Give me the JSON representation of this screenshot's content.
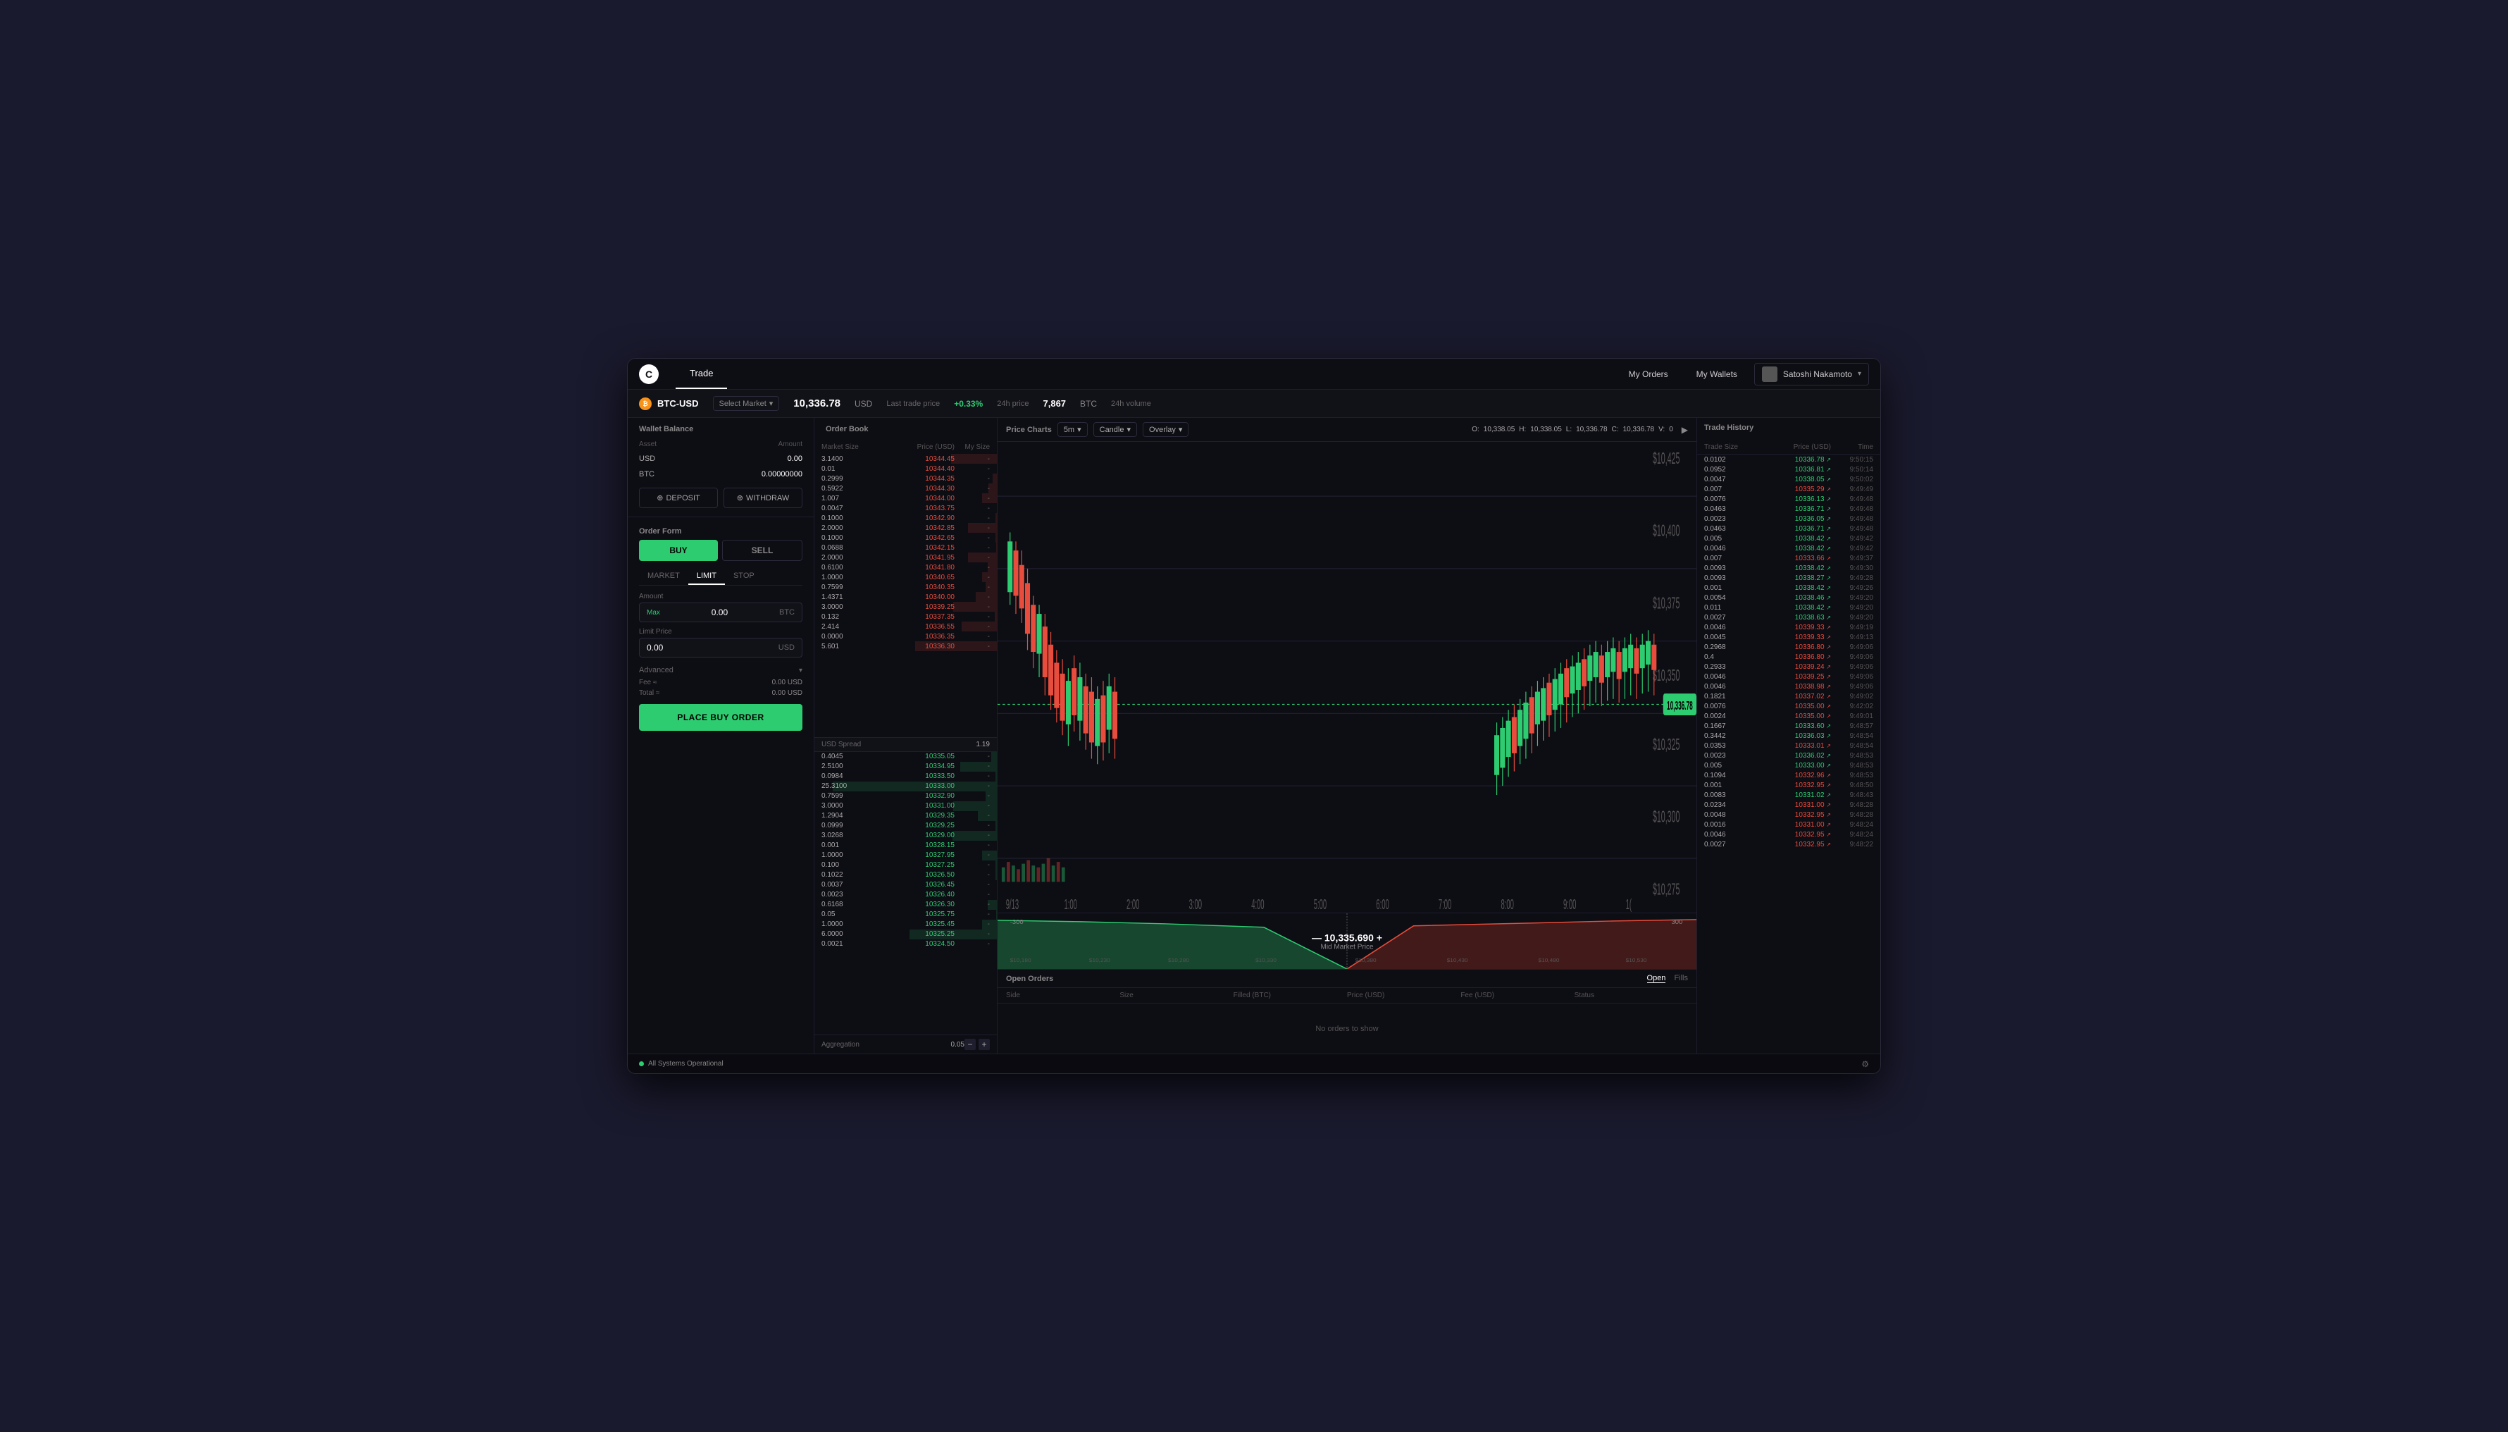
{
  "window": {
    "title": "Coinbase Pro",
    "logo": "C"
  },
  "nav": {
    "tabs": [
      {
        "label": "Trade",
        "active": true
      }
    ],
    "my_orders": "My Orders",
    "my_wallets": "My Wallets",
    "user": "Satoshi Nakamoto"
  },
  "ticker": {
    "pair": "BTC-USD",
    "market_select": "Select Market",
    "last_price": "10,336.78",
    "last_price_unit": "USD",
    "last_price_label": "Last trade price",
    "change_24h": "+0.33%",
    "change_24h_label": "24h price",
    "volume_24h": "7,867",
    "volume_24h_unit": "BTC",
    "volume_24h_label": "24h volume"
  },
  "wallet": {
    "section_title": "Wallet Balance",
    "columns": {
      "asset": "Asset",
      "amount": "Amount"
    },
    "assets": [
      {
        "name": "USD",
        "amount": "0.00"
      },
      {
        "name": "BTC",
        "amount": "0.00000000"
      }
    ],
    "deposit_btn": "DEPOSIT",
    "withdraw_btn": "WITHDRAW"
  },
  "order_form": {
    "section_title": "Order Form",
    "buy_label": "BUY",
    "sell_label": "SELL",
    "types": [
      "MARKET",
      "LIMIT",
      "STOP"
    ],
    "active_type": "LIMIT",
    "amount_label": "Amount",
    "amount_value": "0.00",
    "amount_unit": "BTC",
    "max_link": "Max",
    "limit_price_label": "Limit Price",
    "limit_price_value": "0.00",
    "limit_price_unit": "USD",
    "advanced_label": "Advanced",
    "fee_label": "Fee ≈",
    "fee_value": "0.00 USD",
    "total_label": "Total ≈",
    "total_value": "0.00 USD",
    "place_order_btn": "PLACE BUY ORDER"
  },
  "order_book": {
    "section_title": "Order Book",
    "columns": {
      "market_size": "Market Size",
      "price": "Price (USD)",
      "my_size": "My Size"
    },
    "asks": [
      {
        "size": "3.1400",
        "price": "10344.45",
        "my_size": "-"
      },
      {
        "size": "0.01",
        "price": "10344.40",
        "my_size": "-"
      },
      {
        "size": "0.2999",
        "price": "10344.35",
        "my_size": "-"
      },
      {
        "size": "0.5922",
        "price": "10344.30",
        "my_size": "-"
      },
      {
        "size": "1.007",
        "price": "10344.00",
        "my_size": "-"
      },
      {
        "size": "0.0047",
        "price": "10343.75",
        "my_size": "-"
      },
      {
        "size": "0.1000",
        "price": "10342.90",
        "my_size": "-"
      },
      {
        "size": "2.0000",
        "price": "10342.85",
        "my_size": "-"
      },
      {
        "size": "0.1000",
        "price": "10342.65",
        "my_size": "-"
      },
      {
        "size": "0.0688",
        "price": "10342.15",
        "my_size": "-"
      },
      {
        "size": "2.0000",
        "price": "10341.95",
        "my_size": "-"
      },
      {
        "size": "0.6100",
        "price": "10341.80",
        "my_size": "-"
      },
      {
        "size": "1.0000",
        "price": "10340.65",
        "my_size": "-"
      },
      {
        "size": "0.7599",
        "price": "10340.35",
        "my_size": "-"
      },
      {
        "size": "1.4371",
        "price": "10340.00",
        "my_size": "-"
      },
      {
        "size": "3.0000",
        "price": "10339.25",
        "my_size": "-"
      },
      {
        "size": "0.132",
        "price": "10337.35",
        "my_size": "-"
      },
      {
        "size": "2.414",
        "price": "10336.55",
        "my_size": "-"
      },
      {
        "size": "0.0000",
        "price": "10336.35",
        "my_size": "-"
      },
      {
        "size": "5.601",
        "price": "10336.30",
        "my_size": "-"
      }
    ],
    "spread_label": "USD Spread",
    "spread_value": "1.19",
    "bids": [
      {
        "size": "0.4045",
        "price": "10335.05",
        "my_size": "-"
      },
      {
        "size": "2.5100",
        "price": "10334.95",
        "my_size": "-"
      },
      {
        "size": "0.0984",
        "price": "10333.50",
        "my_size": "-"
      },
      {
        "size": "25.3100",
        "price": "10333.00",
        "my_size": "-"
      },
      {
        "size": "0.7599",
        "price": "10332.90",
        "my_size": "-"
      },
      {
        "size": "3.0000",
        "price": "10331.00",
        "my_size": "-"
      },
      {
        "size": "1.2904",
        "price": "10329.35",
        "my_size": "-"
      },
      {
        "size": "0.0999",
        "price": "10329.25",
        "my_size": "-"
      },
      {
        "size": "3.0268",
        "price": "10329.00",
        "my_size": "-"
      },
      {
        "size": "0.001",
        "price": "10328.15",
        "my_size": "-"
      },
      {
        "size": "1.0000",
        "price": "10327.95",
        "my_size": "-"
      },
      {
        "size": "0.100",
        "price": "10327.25",
        "my_size": "-"
      },
      {
        "size": "0.1022",
        "price": "10326.50",
        "my_size": "-"
      },
      {
        "size": "0.0037",
        "price": "10326.45",
        "my_size": "-"
      },
      {
        "size": "0.0023",
        "price": "10326.40",
        "my_size": "-"
      },
      {
        "size": "0.6168",
        "price": "10326.30",
        "my_size": "-"
      },
      {
        "size": "0.05",
        "price": "10325.75",
        "my_size": "-"
      },
      {
        "size": "1.0000",
        "price": "10325.45",
        "my_size": "-"
      },
      {
        "size": "6.0000",
        "price": "10325.25",
        "my_size": "-"
      },
      {
        "size": "0.0021",
        "price": "10324.50",
        "my_size": "-"
      }
    ],
    "aggregation_label": "Aggregation",
    "aggregation_value": "0.05"
  },
  "chart": {
    "section_title": "Price Charts",
    "timeframe": "5m",
    "chart_type": "Candle",
    "overlay": "Overlay",
    "ohlcv": {
      "o_label": "O:",
      "o_val": "10,338.05",
      "h_label": "H:",
      "h_val": "10,338.05",
      "l_label": "L:",
      "l_val": "10,336.78",
      "c_label": "C:",
      "c_val": "10,336.78",
      "v_label": "V:",
      "v_val": "0"
    },
    "price_high": "$10,425",
    "price_low": "$10,275",
    "current_price": "$10,336.78",
    "mid_price": "10,335.690",
    "mid_price_label": "Mid Market Price",
    "depth_labels": [
      "-300",
      "300"
    ],
    "depth_prices": [
      "$10,180",
      "$10,230",
      "$10,280",
      "$10,330",
      "$10,380",
      "$10,430",
      "$10,480",
      "$10,530"
    ],
    "time_labels": [
      "9/13",
      "1:00",
      "2:00",
      "3:00",
      "4:00",
      "5:00",
      "6:00",
      "7:00",
      "8:00",
      "9:00",
      "1("
    ]
  },
  "open_orders": {
    "section_title": "Open Orders",
    "open_tab": "Open",
    "fills_tab": "Fills",
    "columns": [
      "Side",
      "Size",
      "Filled (BTC)",
      "Price (USD)",
      "Fee (USD)",
      "Status"
    ],
    "empty_message": "No orders to show"
  },
  "trade_history": {
    "section_title": "Trade History",
    "columns": {
      "trade_size": "Trade Size",
      "price": "Price (USD)",
      "time": "Time"
    },
    "trades": [
      {
        "size": "0.0102",
        "price": "10336.78",
        "dir": "up",
        "time": "9:50:15"
      },
      {
        "size": "0.0952",
        "price": "10336.81",
        "dir": "up",
        "time": "9:50:14"
      },
      {
        "size": "0.0047",
        "price": "10338.05",
        "dir": "up",
        "time": "9:50:02"
      },
      {
        "size": "0.007",
        "price": "10335.29",
        "dir": "dn",
        "time": "9:49:49"
      },
      {
        "size": "0.0076",
        "price": "10336.13",
        "dir": "up",
        "time": "9:49:48"
      },
      {
        "size": "0.0463",
        "price": "10336.71",
        "dir": "up",
        "time": "9:49:48"
      },
      {
        "size": "0.0023",
        "price": "10336.05",
        "dir": "up",
        "time": "9:49:48"
      },
      {
        "size": "0.0463",
        "price": "10336.71",
        "dir": "up",
        "time": "9:49:48"
      },
      {
        "size": "0.005",
        "price": "10338.42",
        "dir": "up",
        "time": "9:49:42"
      },
      {
        "size": "0.0046",
        "price": "10338.42",
        "dir": "up",
        "time": "9:49:42"
      },
      {
        "size": "0.007",
        "price": "10333.66",
        "dir": "dn",
        "time": "9:49:37"
      },
      {
        "size": "0.0093",
        "price": "10338.42",
        "dir": "up",
        "time": "9:49:30"
      },
      {
        "size": "0.0093",
        "price": "10338.27",
        "dir": "up",
        "time": "9:49:28"
      },
      {
        "size": "0.001",
        "price": "10338.42",
        "dir": "up",
        "time": "9:49:26"
      },
      {
        "size": "0.0054",
        "price": "10338.46",
        "dir": "up",
        "time": "9:49:20"
      },
      {
        "size": "0.011",
        "price": "10338.42",
        "dir": "up",
        "time": "9:49:20"
      },
      {
        "size": "0.0027",
        "price": "10338.63",
        "dir": "up",
        "time": "9:49:20"
      },
      {
        "size": "0.0046",
        "price": "10339.33",
        "dir": "dn",
        "time": "9:49:19"
      },
      {
        "size": "0.0045",
        "price": "10339.33",
        "dir": "dn",
        "time": "9:49:13"
      },
      {
        "size": "0.2968",
        "price": "10336.80",
        "dir": "dn",
        "time": "9:49:06"
      },
      {
        "size": "0.4",
        "price": "10336.80",
        "dir": "dn",
        "time": "9:49:06"
      },
      {
        "size": "0.2933",
        "price": "10339.24",
        "dir": "dn",
        "time": "9:49:06"
      },
      {
        "size": "0.0046",
        "price": "10339.25",
        "dir": "dn",
        "time": "9:49:06"
      },
      {
        "size": "0.0046",
        "price": "10338.98",
        "dir": "dn",
        "time": "9:49:06"
      },
      {
        "size": "0.1821",
        "price": "10337.02",
        "dir": "dn",
        "time": "9:49:02"
      },
      {
        "size": "0.0076",
        "price": "10335.00",
        "dir": "dn",
        "time": "9:42:02"
      },
      {
        "size": "0.0024",
        "price": "10335.00",
        "dir": "dn",
        "time": "9:49:01"
      },
      {
        "size": "0.1667",
        "price": "10333.60",
        "dir": "up",
        "time": "9:48:57"
      },
      {
        "size": "0.3442",
        "price": "10336.03",
        "dir": "up",
        "time": "9:48:54"
      },
      {
        "size": "0.0353",
        "price": "10333.01",
        "dir": "dn",
        "time": "9:48:54"
      },
      {
        "size": "0.0023",
        "price": "10336.02",
        "dir": "up",
        "time": "9:48:53"
      },
      {
        "size": "0.005",
        "price": "10333.00",
        "dir": "up",
        "time": "9:48:53"
      },
      {
        "size": "0.1094",
        "price": "10332.96",
        "dir": "dn",
        "time": "9:48:53"
      },
      {
        "size": "0.001",
        "price": "10332.95",
        "dir": "dn",
        "time": "9:48:50"
      },
      {
        "size": "0.0083",
        "price": "10331.02",
        "dir": "up",
        "time": "9:48:43"
      },
      {
        "size": "0.0234",
        "price": "10331.00",
        "dir": "dn",
        "time": "9:48:28"
      },
      {
        "size": "0.0048",
        "price": "10332.95",
        "dir": "dn",
        "time": "9:48:28"
      },
      {
        "size": "0.0016",
        "price": "10331.00",
        "dir": "dn",
        "time": "9:48:24"
      },
      {
        "size": "0.0046",
        "price": "10332.95",
        "dir": "dn",
        "time": "9:48:24"
      },
      {
        "size": "0.0027",
        "price": "10332.95",
        "dir": "dn",
        "time": "9:48:22"
      }
    ]
  },
  "status_bar": {
    "status": "All Systems Operational",
    "gear_icon": "⚙"
  }
}
